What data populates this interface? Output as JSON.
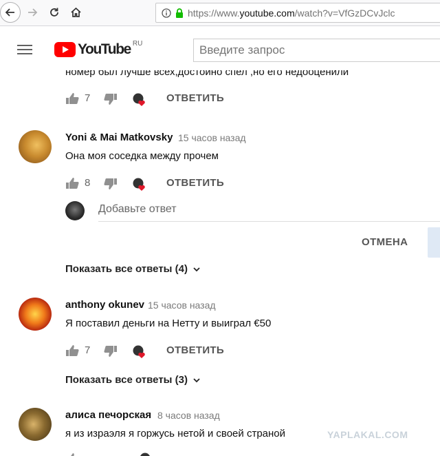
{
  "browser": {
    "url_prefix": "https://www.",
    "url_host": "youtube.com",
    "url_path": "/watch?v=VfGzDCvJclc"
  },
  "header": {
    "logo_text": "YouTube",
    "logo_region": "RU",
    "search_placeholder": "Введите запрос"
  },
  "cut_comment_text": "номер был лучше всех,достойно спел ,но его недооценили",
  "comments": [
    {
      "likes": "7",
      "reply_label": "ОТВЕТИТЬ"
    },
    {
      "author": "Yoni & Mai Matkovsky",
      "time": "15 часов назад",
      "text": "Она моя соседка между прочем",
      "likes": "8",
      "reply_label": "ОТВЕТИТЬ"
    },
    {
      "author": "anthony okunev",
      "time": "15 часов назад",
      "text": "Я поставил деньги на Нетту и выиграл €50",
      "likes": "7",
      "reply_label": "ОТВЕТИТЬ"
    },
    {
      "author": "алиса печорская",
      "time": "8 часов назад",
      "text": "я из израэля я горжусь нетой и своей страной"
    }
  ],
  "reply_box": {
    "placeholder": "Добавьте ответ",
    "cancel_label": "ОТМЕНА"
  },
  "show_replies": [
    "Показать все ответы (4)",
    "Показать все ответы (3)"
  ],
  "watermark": "YAPLAKAL.COM",
  "colors": {
    "brand_red": "#ff0000",
    "heart_red": "#e0182a"
  }
}
